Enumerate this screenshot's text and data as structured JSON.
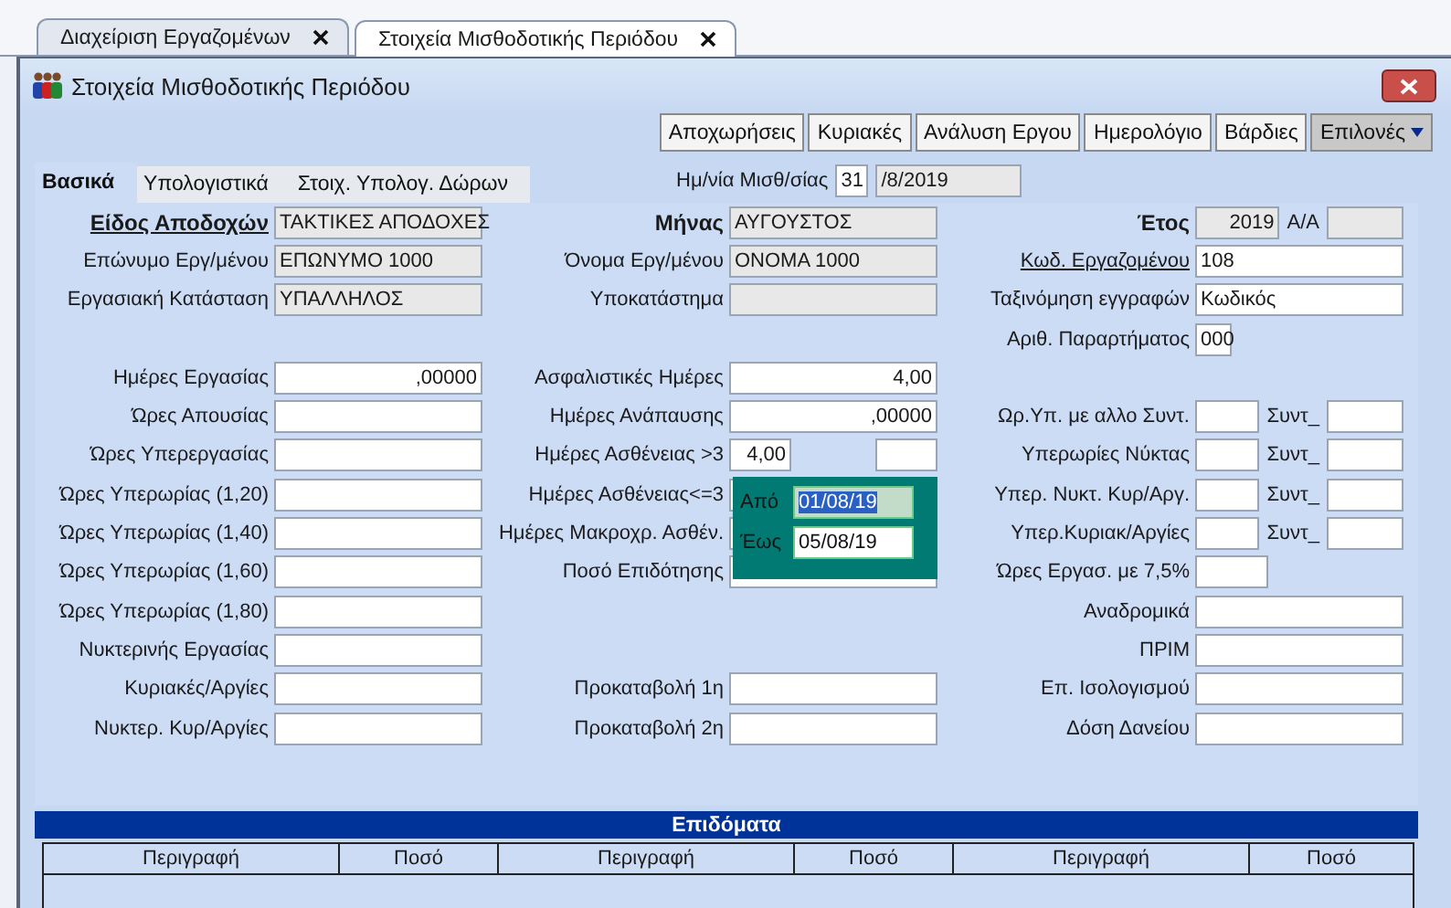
{
  "document_tabs": [
    {
      "label": "Διαχείριση Εργαζομένων",
      "selected": false
    },
    {
      "label": "Στοιχεία Μισθοδοτικής Περιόδου",
      "selected": true
    }
  ],
  "window": {
    "title": "Στοιχεία Μισθοδοτικής Περιόδου"
  },
  "toolbar": [
    {
      "label": "Αποχωρήσεις",
      "kind": "button"
    },
    {
      "label": "Κυριακές",
      "kind": "button"
    },
    {
      "label": "Ανάλυση Εργου",
      "kind": "button"
    },
    {
      "label": "Ημερολόγιο",
      "kind": "button"
    },
    {
      "label": "Βάρδιες",
      "kind": "button"
    },
    {
      "label": "Επιλονές",
      "kind": "menu"
    }
  ],
  "tabs": [
    {
      "label": "Βασικά",
      "selected": true
    },
    {
      "label": "Υπολογιστικά",
      "selected": false
    },
    {
      "label": "Στοιχ. Υπολογ. Δώρων",
      "selected": false
    }
  ],
  "payroll_date": {
    "label": "Ημ/νία Μισθ/σίας",
    "day": "31",
    "rest": "/8/2019"
  },
  "columns": [
    [
      {
        "label": "Είδος Αποδοχών",
        "link": true,
        "kind": "wide",
        "fields": [
          {
            "value": "ΤΑΚΤΙΚΕΣ ΑΠΟΔΟΧΕΣ",
            "readonly": true
          }
        ]
      },
      {
        "label": "Επώνυμο Εργ/μένου",
        "kind": "wide",
        "fields": [
          {
            "value": "ΕΠΩΝΥΜΟ 1000",
            "readonly": true
          }
        ]
      },
      {
        "label": "Εργασιακή Κατάσταση",
        "kind": "wide",
        "fields": [
          {
            "value": "ΥΠΑΛΛΗΛΟΣ",
            "readonly": true
          }
        ]
      },
      {
        "kind": "blank"
      },
      {
        "label": "Ημέρες Εργασίας",
        "kind": "number",
        "fields": [
          {
            "value": ",00000",
            "readonly": false
          }
        ]
      },
      {
        "label": "Ώρες Απουσίας",
        "kind": "wide",
        "fields": [
          {
            "readonly": false
          }
        ]
      },
      {
        "label": "Ώρες Υπερεργασίας",
        "kind": "wide",
        "fields": [
          {
            "readonly": false
          }
        ]
      },
      {
        "label": "Ώρες Υπερωρίας (1,20)",
        "kind": "wide",
        "fields": [
          {
            "readonly": false
          }
        ]
      },
      {
        "label": "Ώρες Υπερωρίας (1,40)",
        "kind": "wide",
        "fields": [
          {
            "readonly": false
          }
        ]
      },
      {
        "label": "Ώρες Υπερωρίας (1,60)",
        "kind": "wide",
        "fields": [
          {
            "readonly": false
          }
        ]
      },
      {
        "label": "Ώρες Υπερωρίας (1,80)",
        "kind": "wide",
        "fields": [
          {
            "readonly": false
          }
        ]
      },
      {
        "label": "Νυκτερινής Εργασίας",
        "kind": "wide",
        "fields": [
          {
            "readonly": false
          }
        ]
      },
      {
        "label": "Κυριακές/Αργίες",
        "kind": "wide",
        "fields": [
          {
            "readonly": false
          }
        ]
      },
      {
        "label": "Νυκτερ. Κυρ/Αργίες",
        "kind": "wide",
        "fields": [
          {
            "readonly": false
          }
        ]
      }
    ],
    [
      {
        "label": "Μήνας",
        "link": false,
        "kind": "wide",
        "fields": [
          {
            "value": "ΑΥΓΟΥΣΤΟΣ",
            "readonly": true
          }
        ]
      },
      {
        "label": "Όνομα Εργ/μένου",
        "kind": "wide",
        "fields": [
          {
            "value": "ΟΝΟΜΑ 1000",
            "readonly": true
          }
        ]
      },
      {
        "label": "Υποκατάστημα",
        "kind": "wide",
        "fields": [
          {
            "readonly": true
          }
        ]
      },
      {
        "kind": "blank"
      },
      {
        "label": "Ασφαλιστικές Ημέρες",
        "kind": "number",
        "fields": [
          {
            "value": "4,00",
            "readonly": false
          }
        ]
      },
      {
        "label": "Ημέρες Ανάπαυσης",
        "kind": "number",
        "fields": [
          {
            "value": ",00000",
            "readonly": false
          }
        ]
      },
      {
        "label": "Ημέρες Ασθένειας >3",
        "kind": "split",
        "fields": [
          {
            "value": "4,00",
            "readonly": false
          },
          {
            "readonly": false
          }
        ]
      },
      {
        "label": "Ημέρες Ασθένειας<=3",
        "kind": "wide",
        "fields": [
          {
            "readonly": false
          }
        ]
      },
      {
        "label": "Ημέρες Μακροχρ. Ασθέν.",
        "kind": "wide",
        "fields": [
          {
            "readonly": false
          }
        ]
      },
      {
        "label": "Ποσό Επιδότησης",
        "kind": "wide",
        "fields": [
          {
            "readonly": false
          }
        ]
      },
      {
        "kind": "blank"
      },
      {
        "kind": "blank"
      },
      {
        "label": "Προκαταβολή 1η",
        "kind": "wide",
        "fields": [
          {
            "readonly": false
          }
        ]
      },
      {
        "label": "Προκαταβολή 2η",
        "kind": "wide",
        "fields": [
          {
            "readonly": false
          }
        ]
      }
    ],
    [
      {
        "label": "Έτος",
        "link": false,
        "kind": "pair",
        "sub_label": "A/A",
        "fields": [
          {
            "value": "2019",
            "readonly": true
          },
          {
            "readonly": true
          }
        ]
      },
      {
        "label": "Κωδ. Εργαζομένου",
        "link": true,
        "kind": "wide",
        "fields": [
          {
            "value": "108",
            "readonly": false
          }
        ]
      },
      {
        "label": "Ταξινόμηση εγγραφών",
        "kind": "wide",
        "fields": [
          {
            "value": "Κωδικός",
            "readonly": false
          }
        ]
      },
      {
        "label": "Αριθ. Παραρτήματος",
        "kind": "tiny",
        "fields": [
          {
            "value": "000",
            "readonly": false
          }
        ]
      },
      {
        "kind": "blank"
      },
      {
        "label": "Ωρ.Υπ. με αλλο Συντ.",
        "kind": "pair",
        "sub_label": "Συντ_",
        "fields": [
          {
            "readonly": false
          },
          {
            "readonly": false
          }
        ]
      },
      {
        "label": "Υπερωρίες Νύκτας",
        "kind": "pair",
        "sub_label": "Συντ_",
        "fields": [
          {
            "readonly": false
          },
          {
            "readonly": false
          }
        ]
      },
      {
        "label": "Υπερ. Νυκτ. Κυρ/Αργ.",
        "kind": "pair",
        "sub_label": "Συντ_",
        "fields": [
          {
            "readonly": false
          },
          {
            "readonly": false
          }
        ]
      },
      {
        "label": "Υπερ.Κυριακ/Αργίες",
        "kind": "pair",
        "sub_label": "Συντ_",
        "fields": [
          {
            "readonly": false
          },
          {
            "readonly": false
          }
        ]
      },
      {
        "label": "Ώρες Εργασ. με 7,5%",
        "kind": "small",
        "fields": [
          {
            "readonly": false
          }
        ]
      },
      {
        "label": "Αναδρομικά",
        "kind": "wide",
        "fields": [
          {
            "readonly": false
          }
        ]
      },
      {
        "label": "ΠΡΙΜ",
        "kind": "wide",
        "fields": [
          {
            "readonly": false
          }
        ]
      },
      {
        "label": "Επ. Ισολογισμού",
        "kind": "wide",
        "fields": [
          {
            "readonly": false
          }
        ]
      },
      {
        "label": "Δόση Δανείου",
        "kind": "wide",
        "fields": [
          {
            "readonly": false
          }
        ]
      }
    ]
  ],
  "date_popup": [
    {
      "label": "Από",
      "value": "01/08/19",
      "selected": true
    },
    {
      "label": "Έως",
      "value": "05/08/19",
      "selected": false
    }
  ],
  "allowances": {
    "title": "Επιδόματα",
    "columns": [
      "Περιγραφή",
      "Ποσό",
      "Περιγραφή",
      "Ποσό",
      "Περιγραφή",
      "Ποσό"
    ]
  }
}
